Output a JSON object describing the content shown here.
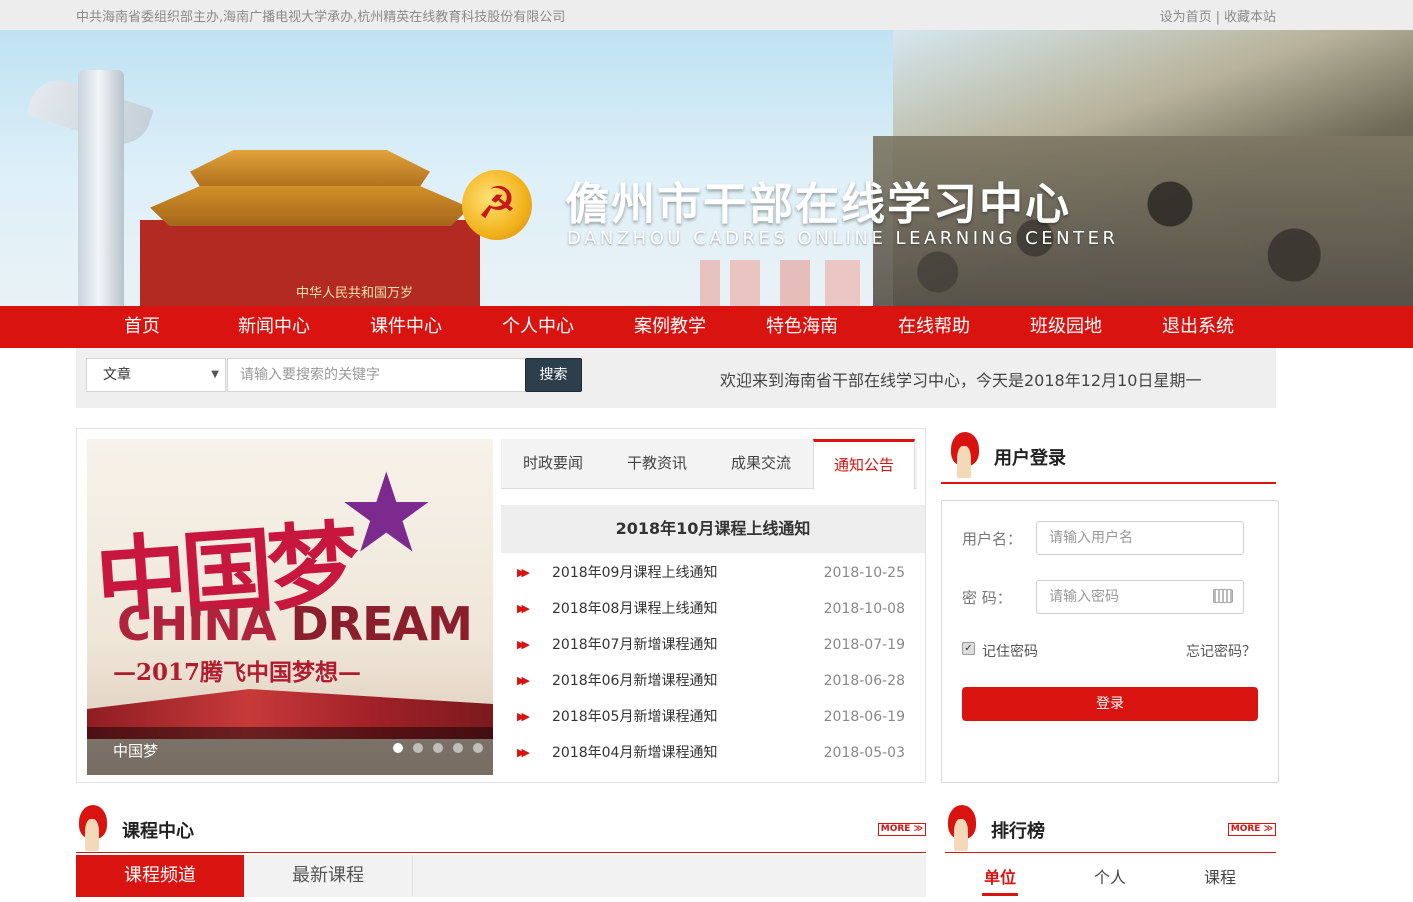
{
  "topbar": {
    "org_text": "中共海南省委组织部主办,海南广播电视大学承办,杭州精英在线教育科技股份有限公司",
    "set_home": "设为首页",
    "separator": "|",
    "bookmark": "收藏本站"
  },
  "banner": {
    "title": "儋州市干部在线学习中心",
    "subtitle": "DANZHOU CADRES ONLINE LEARNING CENTER",
    "gate_sign": "中华人民共和国万岁",
    "emblem_icon": "party-emblem-icon"
  },
  "nav": {
    "items": [
      "首页",
      "新闻中心",
      "课件中心",
      "个人中心",
      "案例教学",
      "特色海南",
      "在线帮助",
      "班级园地",
      "退出系统"
    ]
  },
  "search": {
    "category": "文章",
    "placeholder": "请输入要搜索的关键字",
    "button": "搜索",
    "welcome": "欢迎来到海南省干部在线学习中心，今天是2018年12月10日星期一"
  },
  "slider": {
    "headline_cn": "中国梦",
    "headline_en_1": "CHINA",
    "headline_en_2": "DREAM",
    "slogan": "—2017腾飞中国梦想—",
    "caption": "中国梦",
    "dots": 5,
    "active_dot": 1
  },
  "news": {
    "tabs": [
      "时政要闻",
      "干教资讯",
      "成果交流",
      "通知公告"
    ],
    "active_tab": "通知公告",
    "headline": "2018年10月课程上线通知",
    "items": [
      {
        "title": "2018年09月课程上线通知",
        "date": "2018-10-25"
      },
      {
        "title": "2018年08月课程上线通知",
        "date": "2018-10-08"
      },
      {
        "title": "2018年07月新增课程通知",
        "date": "2018-07-19"
      },
      {
        "title": "2018年06月新增课程通知",
        "date": "2018-06-28"
      },
      {
        "title": "2018年05月新增课程通知",
        "date": "2018-06-19"
      },
      {
        "title": "2018年04月新增课程通知",
        "date": "2018-05-03"
      }
    ]
  },
  "login": {
    "heading": "用户登录",
    "username_label": "用户名：",
    "username_placeholder": "请输入用户名",
    "password_label": "密 码：",
    "password_placeholder": "请输入密码",
    "remember": "记住密码",
    "forgot": "忘记密码？",
    "submit": "登录"
  },
  "courses": {
    "heading": "课程中心",
    "more": "MORE ≫",
    "tabs": [
      "课程频道",
      "最新课程"
    ],
    "active_tab": "课程频道"
  },
  "ranking": {
    "heading": "排行榜",
    "more": "MORE ≫",
    "tabs": [
      "单位",
      "个人",
      "课程"
    ],
    "active_tab": "单位"
  },
  "colors": {
    "brand_red": "#d9130f",
    "search_button": "#2d3e4d"
  }
}
